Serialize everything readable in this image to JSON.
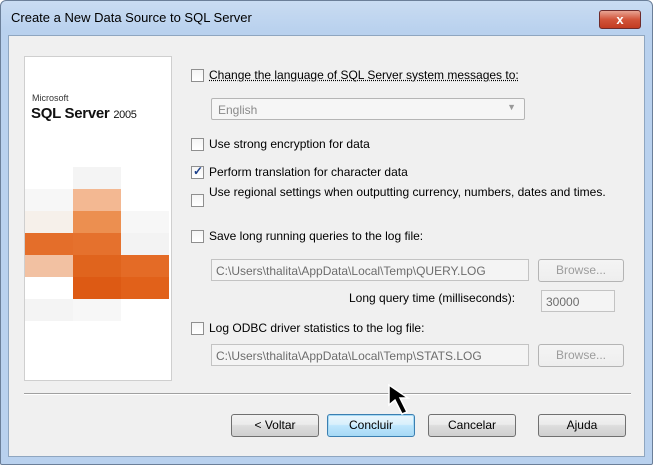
{
  "window": {
    "title": "Create a New Data Source to SQL Server",
    "close_label": "x"
  },
  "logo": {
    "vendor": "Microsoft",
    "product": "SQL Server",
    "version": "2005"
  },
  "options": {
    "change_language_label": "Change the language of SQL Server system messages to:",
    "language_value": "English",
    "strong_encryption_label": "Use strong encryption for data",
    "translation_label": "Perform translation for character data",
    "regional_settings_label": "Use regional settings when outputting currency, numbers, dates and times.",
    "long_queries_label": "Save long running queries to the log file:",
    "long_queries_path": "C:\\Users\\thalita\\AppData\\Local\\Temp\\QUERY.LOG",
    "browse_label": "Browse...",
    "long_query_time_label": "Long query time (milliseconds):",
    "long_query_time_value": "30000",
    "odbc_stats_label": "Log ODBC driver statistics to the log file:",
    "odbc_stats_path": "C:\\Users\\thalita\\AppData\\Local\\Temp\\STATS.LOG"
  },
  "states": {
    "change_language": false,
    "strong_encryption": false,
    "translation": true,
    "regional_settings": false,
    "long_queries": false,
    "odbc_stats": false
  },
  "buttons": {
    "back": "< Voltar",
    "finish": "Concluir",
    "cancel": "Cancelar",
    "help": "Ajuda"
  },
  "icons": {
    "checkmark": "check-icon",
    "dropdown": "chevron-down-icon",
    "cursor": "mouse-pointer-icon"
  }
}
